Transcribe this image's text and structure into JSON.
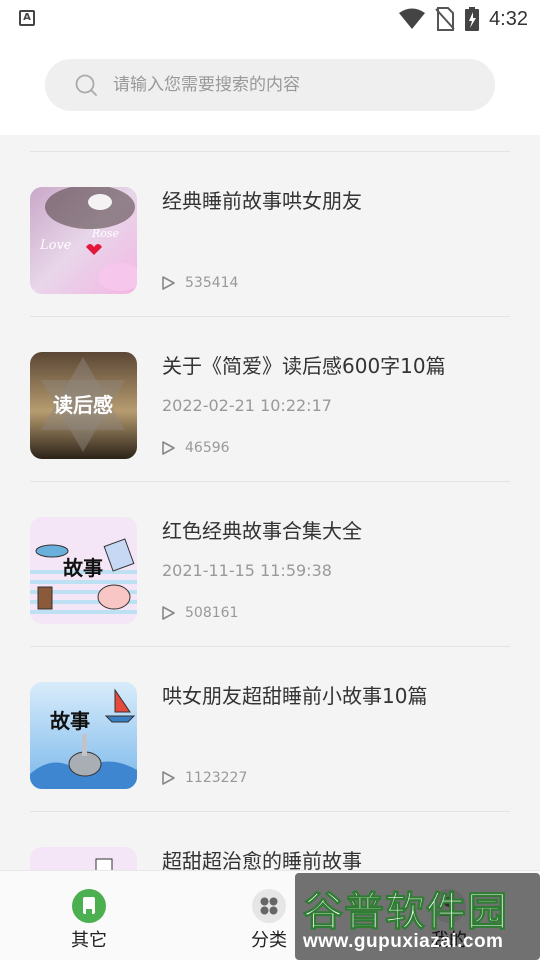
{
  "status_bar": {
    "time": "4:32"
  },
  "search": {
    "placeholder": "请输入您需要搜索的内容"
  },
  "stories": [
    {
      "title": "经典睡前故事哄女朋友",
      "date": "",
      "plays": "535414"
    },
    {
      "title": "关于《简爱》读后感600字10篇",
      "date": "2022-02-21 10:22:17",
      "plays": "46596",
      "thumb_text": "读后感"
    },
    {
      "title": "红色经典故事合集大全",
      "date": "2021-11-15 11:59:38",
      "plays": "508161",
      "thumb_text": "故事"
    },
    {
      "title": "哄女朋友超甜睡前小故事10篇",
      "date": "",
      "plays": "1123227",
      "thumb_text": "故事"
    },
    {
      "title": "超甜超治愈的睡前故事",
      "date": "",
      "plays": ""
    }
  ],
  "tabbar": {
    "tabs": [
      {
        "label": "其它",
        "icon": "book-icon",
        "color": "#4caf50"
      },
      {
        "label": "分类",
        "icon": "grid-icon",
        "color": "#888888"
      },
      {
        "label": "我的",
        "icon": "user-icon",
        "color": "#888888"
      }
    ]
  },
  "watermark": {
    "title": "谷普软件园",
    "url": "www.gupuxiazai.com"
  }
}
